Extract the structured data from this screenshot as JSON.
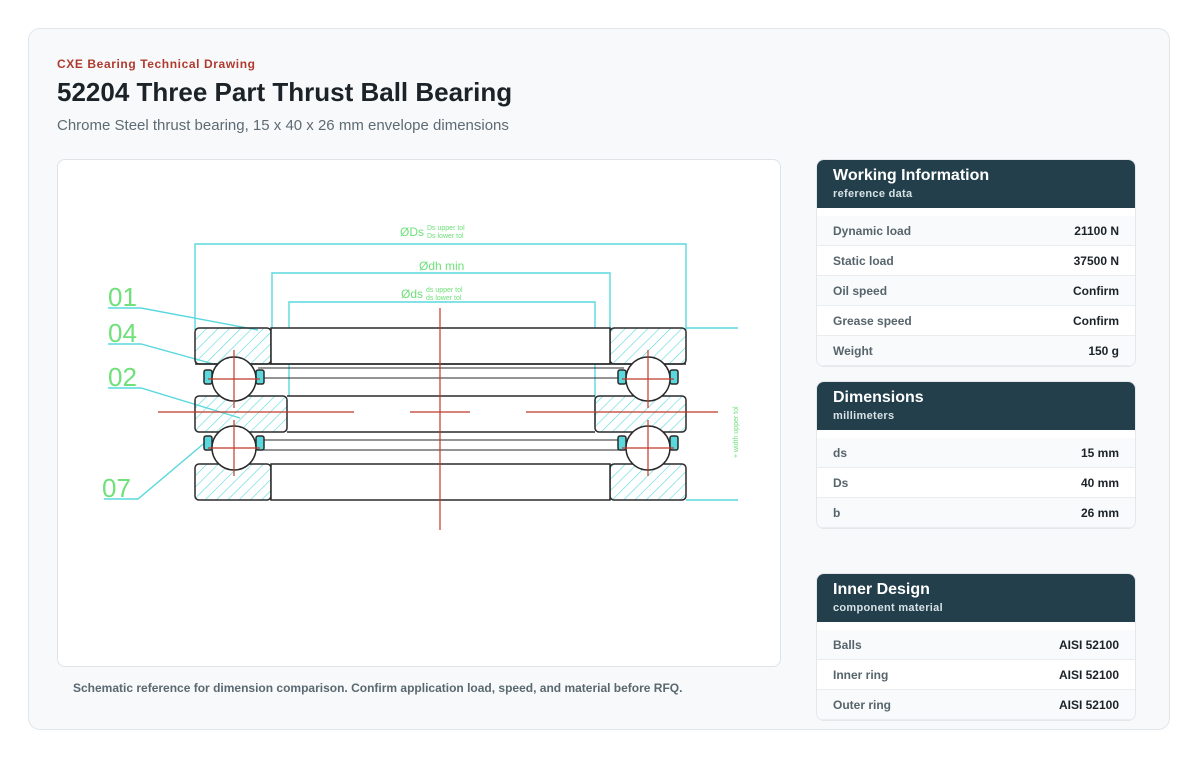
{
  "header": {
    "eyebrow": "CXE Bearing Technical Drawing",
    "title": "52204 Three Part Thrust Ball Bearing",
    "subtitle": "Chrome Steel thrust bearing, 15 x 40 x 26 mm envelope dimensions"
  },
  "drawing": {
    "dim_Ds": "ØDs",
    "dim_Ds_upper": "Ds upper tol",
    "dim_Ds_lower": "Ds lower tol",
    "dim_dh": "Ødh min",
    "dim_ds": "Øds",
    "dim_ds_upper": "ds upper tol",
    "dim_ds_lower": "ds lower tol",
    "width_tol": "width upper tol",
    "width_mark": "+",
    "part_01": "01",
    "part_04": "04",
    "part_02": "02",
    "part_07": "07",
    "colors": {
      "dimension": "#5ad8dd",
      "label": "#6fe07a",
      "centerline": "#c0392b",
      "hatch": "#5ad8dd",
      "outline": "#2a2a2a"
    }
  },
  "caption": "Schematic reference for dimension comparison. Confirm application load, speed, and material before RFQ.",
  "panels": {
    "working": {
      "title": "Working Information",
      "subtitle": "reference data",
      "rows": [
        {
          "k": "Dynamic load",
          "v": "21100 N"
        },
        {
          "k": "Static load",
          "v": "37500 N"
        },
        {
          "k": "Oil speed",
          "v": "Confirm"
        },
        {
          "k": "Grease speed",
          "v": "Confirm"
        },
        {
          "k": "Weight",
          "v": "150 g"
        }
      ]
    },
    "dimensions": {
      "title": "Dimensions",
      "subtitle": "millimeters",
      "rows": [
        {
          "k": "ds",
          "v": "15 mm"
        },
        {
          "k": "Ds",
          "v": "40 mm"
        },
        {
          "k": "b",
          "v": "26 mm"
        }
      ]
    },
    "inner": {
      "title": "Inner Design",
      "subtitle": "component material",
      "rows": [
        {
          "k": "Balls",
          "v": "AISI 52100"
        },
        {
          "k": "Inner ring",
          "v": "AISI 52100"
        },
        {
          "k": "Outer ring",
          "v": "AISI 52100"
        }
      ]
    }
  }
}
